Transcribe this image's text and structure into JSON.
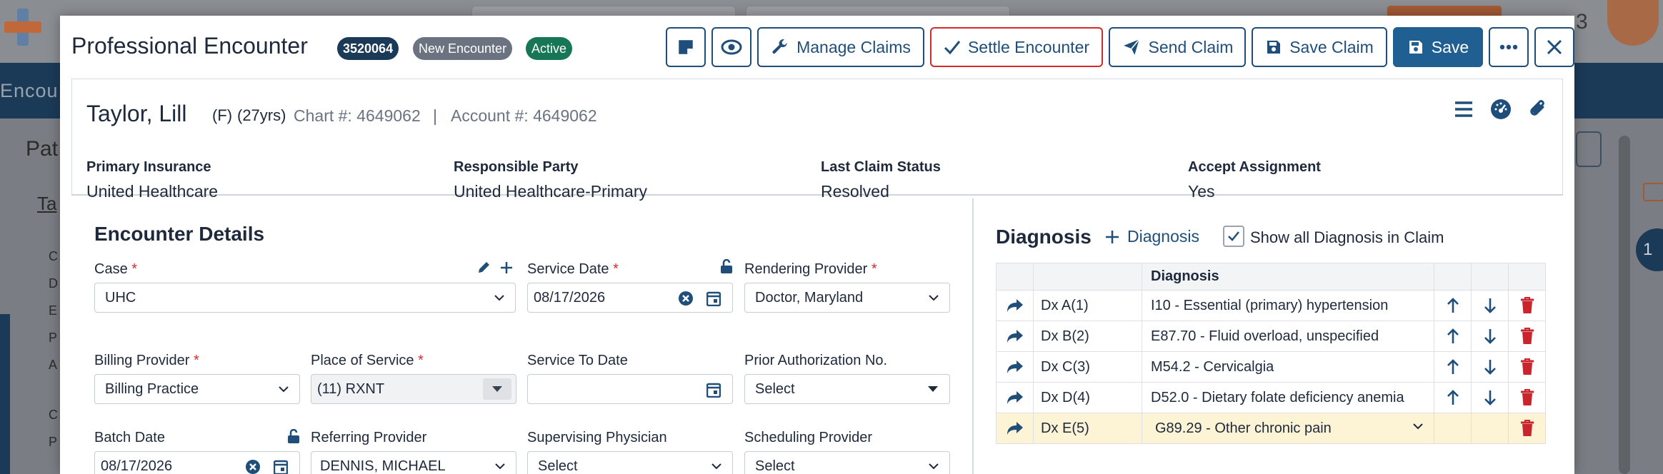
{
  "background": {
    "nav_text": "Encou",
    "page_heading": "Pat",
    "tab_heading": "Ta",
    "left_letters": [
      "C",
      "D",
      "E",
      "P",
      "A",
      "C",
      "P"
    ],
    "notification_count": "3",
    "side_badge": "1"
  },
  "modal": {
    "title": "Professional Encounter",
    "badges": {
      "id": "3520064",
      "status_new": "New Encounter",
      "status_active": "Active"
    },
    "buttons": {
      "manage_claims": "Manage Claims",
      "settle_encounter": "Settle Encounter",
      "send_claim": "Send Claim",
      "save_claim": "Save Claim",
      "save": "Save"
    }
  },
  "patient": {
    "name": "Taylor, Lill",
    "gender": "(F)",
    "age": "(27yrs)",
    "chart": "Chart #: 4649062",
    "separator": "|",
    "account": "Account #: 4649062",
    "fields": [
      {
        "label": "Primary Insurance",
        "value": "United Healthcare"
      },
      {
        "label": "Responsible Party",
        "value": "United Healthcare-Primary"
      },
      {
        "label": "Last Claim Status",
        "value": "Resolved"
      },
      {
        "label": "Accept Assignment",
        "value": "Yes"
      }
    ]
  },
  "encounter": {
    "title": "Encounter Details",
    "case": {
      "label": "Case",
      "value": "UHC"
    },
    "service_date": {
      "label": "Service Date",
      "value": "08/17/2026"
    },
    "rendering_provider": {
      "label": "Rendering Provider",
      "value": "Doctor, Maryland"
    },
    "billing_provider": {
      "label": "Billing Provider",
      "value": "Billing Practice"
    },
    "place_of_service": {
      "label": "Place of Service",
      "value": "(11) RXNT"
    },
    "service_to_date": {
      "label": "Service To Date",
      "value": ""
    },
    "prior_auth": {
      "label": "Prior Authorization No.",
      "value": "Select"
    },
    "batch_date": {
      "label": "Batch Date",
      "value": "08/17/2026"
    },
    "referring_provider": {
      "label": "Referring Provider",
      "value": "DENNIS, MICHAEL"
    },
    "supervising_physician": {
      "label": "Supervising Physician",
      "value": "Select"
    },
    "scheduling_provider": {
      "label": "Scheduling Provider",
      "value": "Select"
    },
    "required_mark": "*"
  },
  "diagnosis": {
    "title": "Diagnosis",
    "add_label": "Diagnosis",
    "show_all_label": "Show all Diagnosis in Claim",
    "show_all_checked": true,
    "column_header": "Diagnosis",
    "rows": [
      {
        "code": "Dx A(1)",
        "desc": "I10 - Essential (primary) hypertension"
      },
      {
        "code": "Dx B(2)",
        "desc": "E87.70 - Fluid overload, unspecified"
      },
      {
        "code": "Dx C(3)",
        "desc": "M54.2 - Cervicalgia"
      },
      {
        "code": "Dx D(4)",
        "desc": "D52.0 - Dietary folate deficiency anemia"
      },
      {
        "code": "Dx E(5)",
        "desc": "G89.29 - Other chronic pain"
      }
    ]
  },
  "colors": {
    "primary": "#1f5f92",
    "navy": "#1b3a58",
    "active_green": "#177656",
    "danger_red": "#c8262c",
    "highlight_row": "#fdf4d6"
  }
}
